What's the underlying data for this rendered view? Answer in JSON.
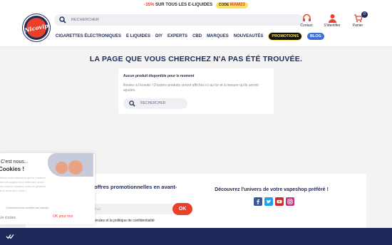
{
  "promo": {
    "discount": "-35%",
    "text": "SUR TOUS LES E-LIQUIDES",
    "code_label": "CODE",
    "code": "MAM23"
  },
  "header": {
    "logo_text": "Nicovip",
    "search_placeholder": "RECHERCHER",
    "icons": [
      {
        "label": "Contact",
        "icon": "headset-icon"
      },
      {
        "label": "S'identifier",
        "icon": "user-icon"
      },
      {
        "label": "Panier",
        "icon": "cart-icon",
        "count": "0"
      }
    ]
  },
  "nav": {
    "items": [
      "CIGARETTES ÉLECTRONIQUES",
      "E LIQUIDES",
      "DIY",
      "EXPERTS",
      "CBD",
      "MARQUES",
      "NOUVEAUTÉS"
    ],
    "promotions": "PROMOTIONS",
    "blog": "BLOG"
  },
  "main": {
    "title": "LA PAGE QUE VOUS CHERCHEZ N'A PAS ÉTÉ TROUVÉE.",
    "card_heading": "Aucun produit disponible pour le moment",
    "card_text": "Restez à l'écoute ! D'autres produits seront affichés ici au fur et à mesure qu'ils seront ajoutés.",
    "search_placeholder": "RECHERCHER"
  },
  "cookie": {
    "title_line1": "C'est nous...",
    "title_line2": "Cookies !",
    "body": "Nous nous assurons que le contenu de nos pages vous intéresse avant de vous le montrer, mais en général tout rond pour vous ?",
    "small": "Consentements certifiés par axeptio",
    "ok": "OK pour moi",
    "choose": "Je choisis"
  },
  "newsletter": {
    "title": "Recevez toutes nos offres promotionnelles en avant-première !",
    "email_placeholder": "Votre adresse e-mail",
    "ok": "OK",
    "consent": "J'accepte les conditions générales et la politique de confidentialité",
    "right_title": "Découvrez l'univers de votre vapeshop préféré !",
    "socials": [
      "facebook-icon",
      "twitter-icon",
      "youtube-icon",
      "instagram-icon"
    ]
  },
  "colors": {
    "primary": "#1f2a5a",
    "accent": "#e8402a",
    "yellow": "#fbe06a",
    "blog": "#3d6fd6"
  }
}
